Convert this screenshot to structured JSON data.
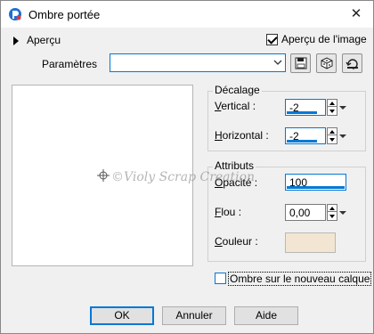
{
  "window": {
    "title": "Ombre portée"
  },
  "apercu": {
    "label": "Aperçu",
    "preview_image_label": "Aperçu de l'image",
    "preview_image_checked": true
  },
  "parametres": {
    "label": "Paramètres",
    "value": ""
  },
  "decalage": {
    "title": "Décalage",
    "vertical_label": "Vertical :",
    "vertical_value": "-2",
    "horizontal_label": "Horizontal :",
    "horizontal_value": "-2"
  },
  "attributs": {
    "title": "Attributs",
    "opacite_label": "Opacité :",
    "opacite_value": "100",
    "flou_label": "Flou :",
    "flou_value": "0,00",
    "couleur_label": "Couleur :",
    "couleur_value": "#f2e6d2"
  },
  "shadow_layer": {
    "label": "Ombre sur le nouveau calque",
    "checked": false
  },
  "buttons": {
    "ok": "OK",
    "cancel": "Annuler",
    "help": "Aide"
  },
  "watermark": "©Violy Scrap Creation",
  "colors": {
    "accent": "#0078d7",
    "swatch": "#f2e6d2"
  }
}
